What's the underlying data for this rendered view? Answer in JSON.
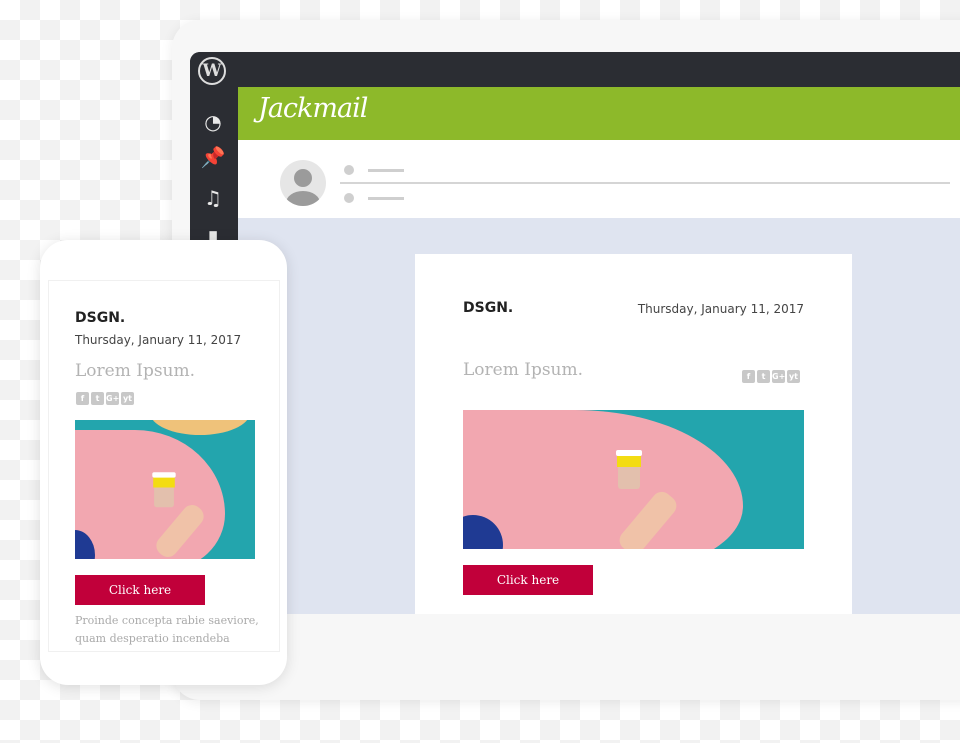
{
  "app": {
    "logo": "Jackmail",
    "wp_logo": "W"
  },
  "sidebar": {
    "icons": [
      "dashboard-icon",
      "pin-icon",
      "media-icon",
      "pages-icon"
    ]
  },
  "email": {
    "brand": "DSGN.",
    "date": "Thursday, January 11, 2017",
    "headline": "Lorem Ipsum.",
    "social": [
      "f",
      "t",
      "G+",
      "yt"
    ],
    "button": "Click here",
    "body": "Proinde concepta rabie saeviore, quam desperatio incendeba"
  },
  "colors": {
    "accent": "#8db92a",
    "button": "#c1003a",
    "sidebar": "#2b2d33"
  }
}
